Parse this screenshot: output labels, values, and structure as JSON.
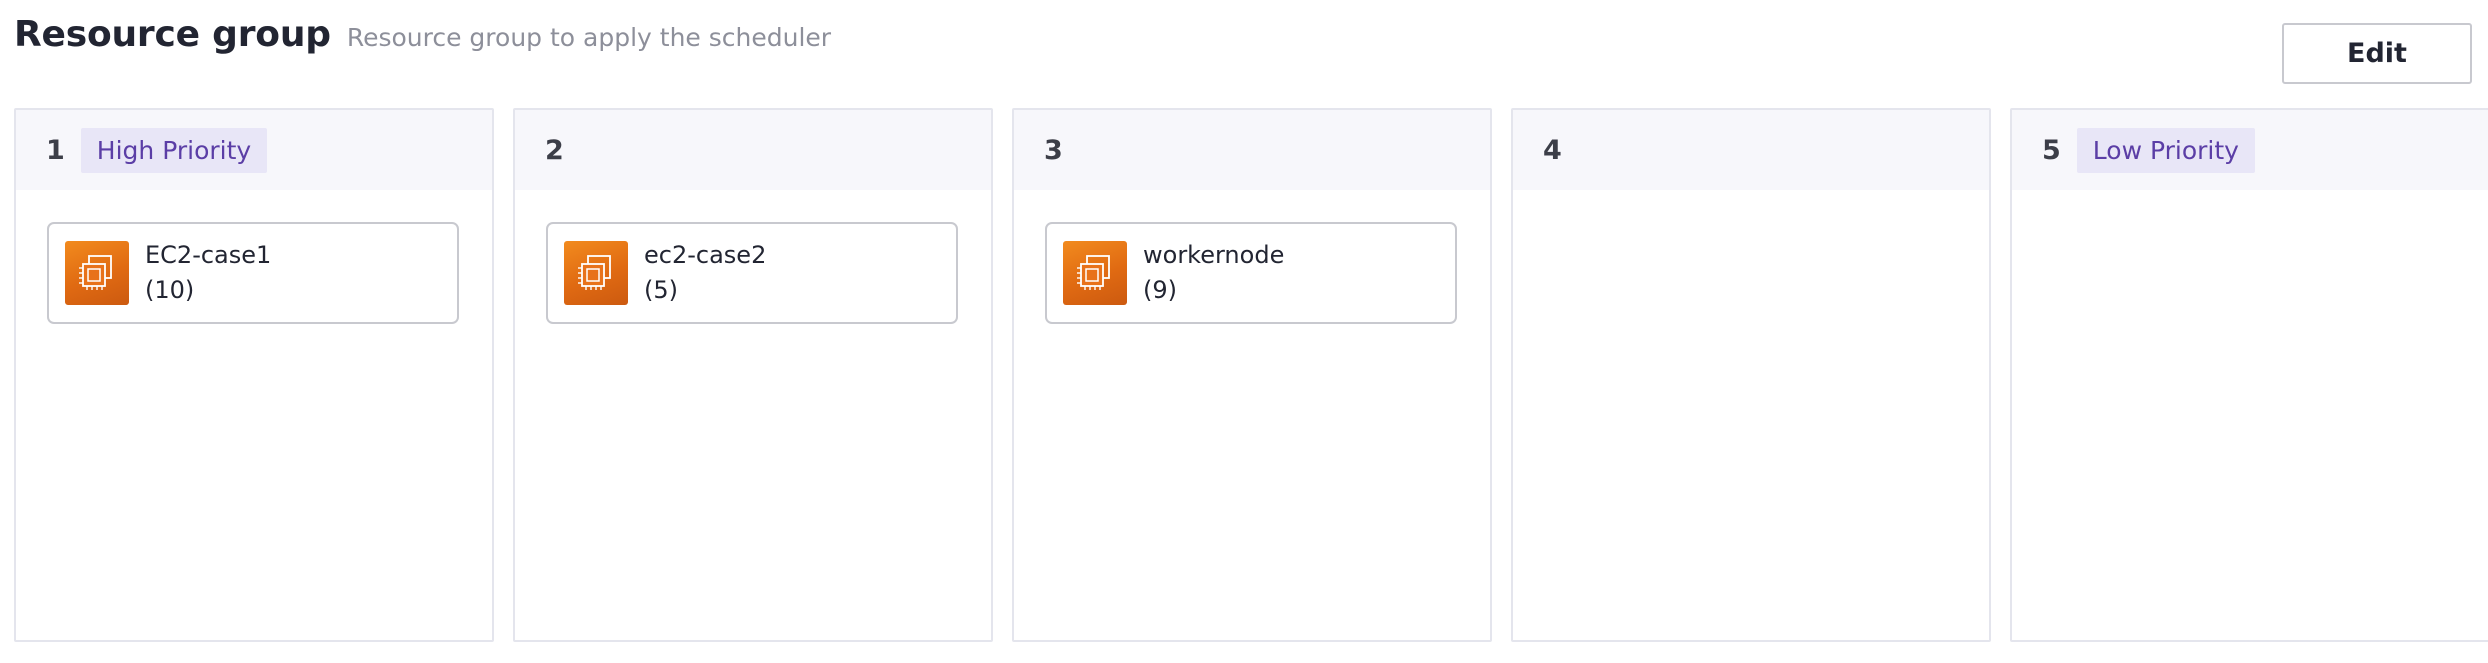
{
  "header": {
    "title": "Resource group",
    "subtitle": "Resource group to apply the scheduler",
    "edit_label": "Edit"
  },
  "colors": {
    "priority_badge_bg": "#e8e6f7",
    "priority_badge_text": "#5b3ea6",
    "ec2_icon": "#e8721a",
    "column_header_bg": "#f7f7fb"
  },
  "columns": [
    {
      "number": "1",
      "priority": "High Priority",
      "resource": {
        "name": "EC2-case1",
        "count": "(10)",
        "icon": "ec2-instance-icon"
      }
    },
    {
      "number": "2",
      "priority": "",
      "resource": {
        "name": "ec2-case2",
        "count": "(5)",
        "icon": "ec2-instance-icon"
      }
    },
    {
      "number": "3",
      "priority": "",
      "resource": {
        "name": "workernode",
        "count": "(9)",
        "icon": "ec2-instance-icon"
      }
    },
    {
      "number": "4",
      "priority": "",
      "resource": null
    },
    {
      "number": "5",
      "priority": "Low Priority",
      "resource": null
    }
  ]
}
